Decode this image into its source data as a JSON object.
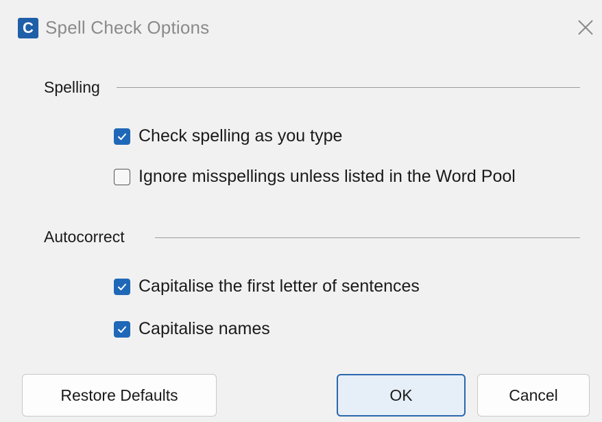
{
  "window": {
    "title": "Spell Check Options",
    "app_icon_letter": "C",
    "accent_color": "#1f68b8"
  },
  "sections": {
    "spelling": {
      "header": "Spelling",
      "options": [
        {
          "label": "Check spelling as you type",
          "checked": true
        },
        {
          "label": "Ignore misspellings unless listed in the Word Pool",
          "checked": false
        }
      ]
    },
    "autocorrect": {
      "header": "Autocorrect",
      "options": [
        {
          "label": "Capitalise the first letter of sentences",
          "checked": true
        },
        {
          "label": "Capitalise names",
          "checked": true
        }
      ]
    }
  },
  "buttons": {
    "restore": "Restore Defaults",
    "ok": "OK",
    "cancel": "Cancel"
  }
}
